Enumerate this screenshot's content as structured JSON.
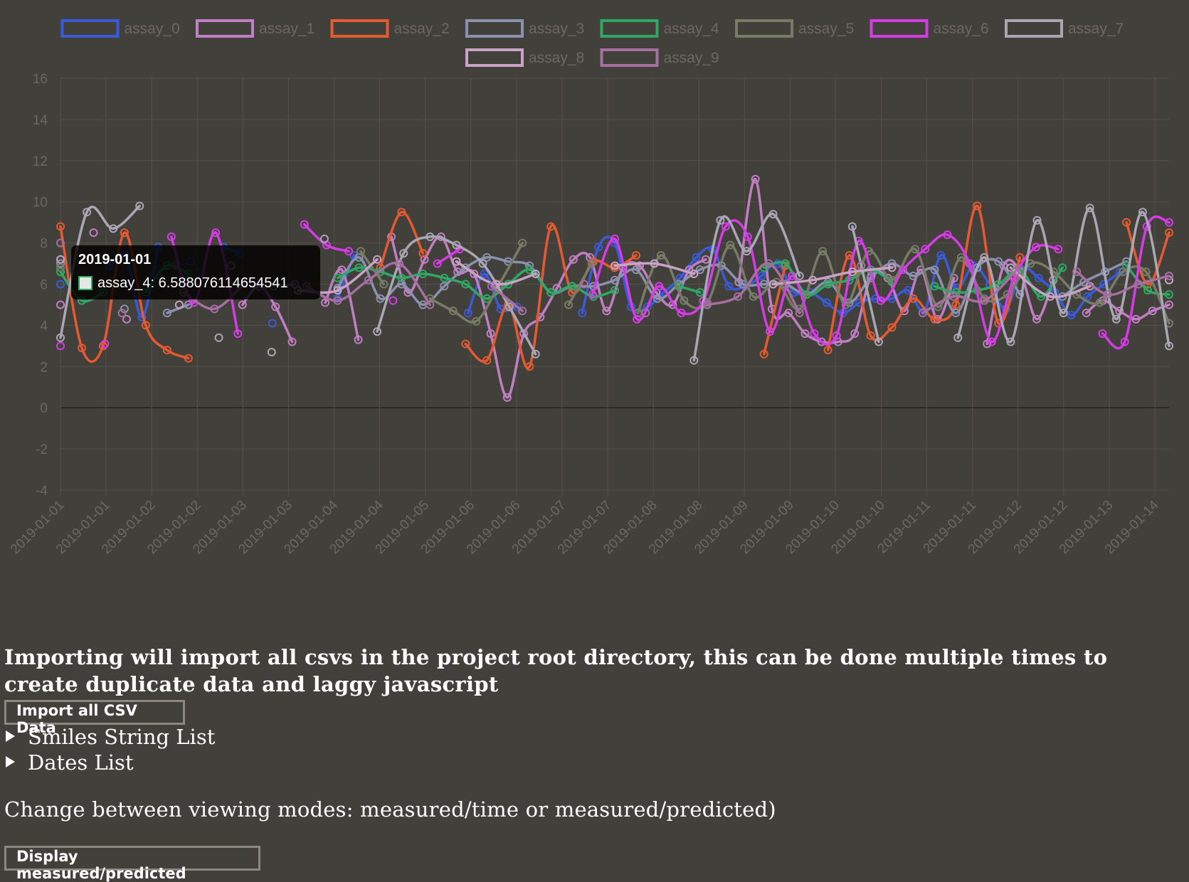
{
  "chart_data": {
    "type": "line",
    "ylim": [
      -4,
      16
    ],
    "yticks": [
      "16",
      "14",
      "12",
      "10",
      "8",
      "6",
      "4",
      "2",
      "0",
      "-2",
      "-4"
    ],
    "x_tick_labels": [
      "2019-01-01",
      "2019-01-01",
      "2019-01-02",
      "2019-01-02",
      "2019-01-03",
      "2019-01-03",
      "2019-01-04",
      "2019-01-04",
      "2019-01-05",
      "2019-01-06",
      "2019-01-06",
      "2019-01-07",
      "2019-01-07",
      "2019-01-08",
      "2019-01-08",
      "2019-01-09",
      "2019-01-09",
      "2019-01-10",
      "2019-01-10",
      "2019-01-11",
      "2019-01-11",
      "2019-01-12",
      "2019-01-12",
      "2019-01-13",
      "2019-01-14"
    ],
    "grid": true,
    "legend_position": "top",
    "series": [
      {
        "name": "assay_0",
        "color": "#3a5bd9",
        "values": [
          6.0,
          null,
          null,
          6.9,
          7.4,
          4.4,
          7.8,
          null,
          7.1,
          null,
          7.8,
          7.5,
          null,
          4.1,
          null,
          null,
          null,
          5.3,
          7.4,
          null,
          null,
          null,
          null,
          null,
          null,
          4.6,
          6.5,
          4.8,
          4.9,
          null,
          null,
          null,
          4.6,
          7.8,
          8.0,
          4.9,
          4.9,
          5.6,
          6.3,
          7.3,
          7.7,
          5.9,
          5.9,
          6.4,
          7.0,
          5.6,
          5.6,
          5.1,
          4.6,
          5.1,
          5.3,
          5.3,
          5.7,
          4.7,
          7.4,
          5.8,
          6.9,
          6.0,
          4.8,
          6.7,
          6.3,
          5.6,
          4.5,
          5.4,
          6.0,
          6.6,
          null,
          null,
          4.1
        ]
      },
      {
        "name": "assay_1",
        "color": "#c17fc3",
        "values": [
          5.0,
          null,
          8.5,
          null,
          4.3,
          null,
          null,
          null,
          null,
          null,
          null,
          5.0,
          5.9,
          4.9,
          3.2,
          null,
          5.1,
          6.7,
          3.3,
          null,
          8.3,
          5.6,
          7.2,
          8.3,
          6.6,
          6.5,
          3.6,
          0.5,
          3.6,
          4.4,
          5.8,
          7.2,
          7.3,
          4.7,
          6.8,
          6.9,
          5.6,
          5.0,
          6.7,
          7.2,
          null,
          6.1,
          11.1,
          4.8,
          4.6,
          3.6,
          3.2,
          3.2,
          3.6,
          6.4,
          6.3,
          4.7,
          6.7,
          4.3,
          6.3,
          null,
          3.1,
          6.9,
          6.6,
          4.3,
          6.2,
          null,
          4.6,
          5.2,
          4.7,
          4.3,
          4.7,
          5.0
        ]
      },
      {
        "name": "assay_2",
        "color": "#e65a32",
        "values": [
          8.8,
          2.9,
          3.0,
          8.5,
          4.0,
          2.8,
          2.4,
          null,
          null,
          null,
          null,
          null,
          null,
          null,
          null,
          6.8,
          9.5,
          7.5,
          null,
          3.1,
          2.3,
          5.0,
          2.0,
          8.8,
          5.6,
          7.1,
          6.8,
          7.4,
          null,
          null,
          null,
          null,
          null,
          2.6,
          6.9,
          null,
          2.8,
          7.4,
          3.5,
          3.9,
          5.3,
          4.3,
          5.0,
          9.8,
          4.1,
          7.3,
          null,
          null,
          null,
          null,
          9.0,
          6.0,
          8.5
        ]
      },
      {
        "name": "assay_3",
        "color": "#8a92ad",
        "values": [
          7.0,
          null,
          null,
          4.8,
          null,
          4.6,
          5.0,
          null,
          6.9,
          null,
          5.9,
          6.0,
          null,
          5.8,
          7.3,
          5.3,
          6.0,
          5.0,
          5.9,
          6.8,
          7.3,
          7.1,
          6.9,
          5.6,
          5.9,
          5.9,
          6.2,
          6.7,
          5.3,
          6.0,
          6.7,
          6.9,
          6.0,
          6.0,
          6.0,
          5.5,
          6.1,
          5.1,
          6.3,
          7.0,
          6.4,
          6.7,
          4.6,
          6.8,
          7.1,
          5.5,
          null,
          5.4,
          6.1,
          6.6,
          7.1,
          null,
          6.4
        ]
      },
      {
        "name": "assay_4",
        "color": "#2fa864",
        "values": [
          6.6,
          5.2,
          5.6,
          null,
          5.6,
          6.9,
          6.5,
          null,
          null,
          null,
          null,
          null,
          null,
          6.3,
          6.8,
          6.6,
          6.3,
          6.5,
          6.3,
          6.0,
          5.3,
          6.0,
          6.7,
          5.6,
          5.9,
          5.4,
          5.7,
          null,
          null,
          5.9,
          5.6,
          null,
          null,
          6.8,
          7.0,
          5.5,
          6.0,
          6.2,
          6.7,
          6.1,
          null,
          5.9,
          5.6,
          5.7,
          6.0,
          6.7,
          5.4,
          6.8,
          null,
          null,
          6.9,
          5.7,
          5.5
        ]
      },
      {
        "name": "assay_5",
        "color": "#777c67",
        "values": [
          6.8,
          null,
          null,
          null,
          null,
          6.9,
          null,
          null,
          null,
          null,
          null,
          null,
          null,
          7.6,
          6.0,
          null,
          5.3,
          4.7,
          4.2,
          6.0,
          8.0,
          null,
          5.0,
          7.0,
          null,
          4.6,
          7.4,
          5.2,
          5.1,
          7.9,
          5.4,
          6.1,
          4.8,
          7.6,
          5.0,
          7.6,
          6.2,
          7.7,
          4.9,
          7.3,
          5.3,
          5.5,
          7.0,
          6.6,
          5.5,
          5.1,
          6.6,
          6.6,
          4.1
        ]
      },
      {
        "name": "assay_6",
        "color": "#d63ce6",
        "values": [
          3.0,
          null,
          3.1,
          null,
          null,
          8.3,
          5.1,
          8.5,
          3.6,
          null,
          null,
          8.9,
          7.9,
          7.6,
          null,
          5.2,
          null,
          7.0,
          7.7,
          null,
          null,
          null,
          null,
          null,
          5.5,
          8.2,
          4.3,
          5.9,
          4.6,
          5.2,
          8.8,
          8.3,
          3.7,
          6.4,
          3.6,
          3.5,
          8.1,
          5.2,
          6.7,
          7.7,
          8.4,
          7.0,
          3.2,
          6.3,
          7.8,
          7.7,
          null,
          3.6,
          3.2,
          8.8,
          9.0
        ]
      },
      {
        "name": "assay_7",
        "color": "#a9a7b4",
        "values": [
          3.4,
          9.5,
          8.7,
          9.8,
          null,
          null,
          3.4,
          null,
          2.7,
          null,
          8.2,
          null,
          3.7,
          7.5,
          8.3,
          7.9,
          7.0,
          4.9,
          2.6,
          null,
          null,
          null,
          null,
          null,
          2.3,
          9.1,
          7.6,
          9.4,
          6.4,
          null,
          8.8,
          3.2,
          null,
          null,
          3.4,
          7.3,
          3.2,
          9.1,
          4.6,
          9.7,
          4.3,
          9.5,
          3.0
        ]
      },
      {
        "name": "assay_8",
        "color": "#c8a3c6",
        "values": [
          7.2,
          null,
          null,
          5.0,
          null,
          null,
          5.7,
          5.7,
          7.2,
          null,
          7.1,
          6.0,
          6.5,
          null,
          6.9,
          7.0,
          6.5,
          null,
          6.0,
          6.2,
          6.6,
          6.8,
          null,
          null,
          6.8,
          5.4,
          5.9,
          null,
          6.2
        ]
      },
      {
        "name": "assay_9",
        "color": "#a56fa0",
        "values": [
          8.0,
          null,
          4.6,
          null,
          5.6,
          4.8,
          6.1,
          null,
          5.9,
          5.2,
          6.2,
          7.0,
          5.0,
          null,
          5.9,
          4.7,
          null,
          6.0,
          null,
          4.6,
          null,
          5.0,
          5.4,
          7.0,
          4.6,
          null,
          6.9,
          null,
          4.6,
          5.4,
          5.2,
          6.6,
          null,
          6.6,
          5.5,
          6.0,
          6.4
        ]
      }
    ]
  },
  "tooltip": {
    "title": "2019-01-01",
    "text": "assay_4: 6.588076114654541",
    "swatch_border": "#2fa864"
  },
  "page": {
    "description": "Importing will import all csvs in the project root directory, this can be done multiple times to create duplicate data and laggy javascript",
    "import_button": "Import all CSV Data",
    "smiles_summary": "Smiles String List",
    "dates_summary": "Dates List",
    "mode_text": "Change between viewing modes: measured/time or measured/predicted)",
    "mode_button": "Display measured/predicted"
  },
  "colors": {
    "background": "#42403b",
    "grid": "#545149",
    "axis_text": "#6b6862",
    "zero_line": "#232220"
  }
}
